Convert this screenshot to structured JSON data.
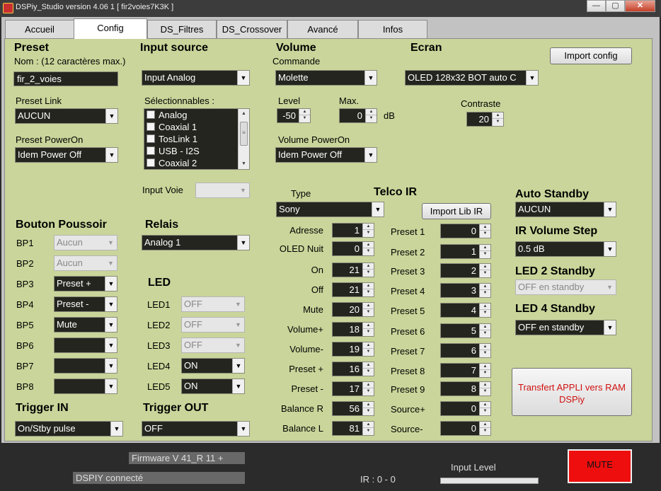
{
  "window": {
    "title": "DSPiy_Studio version 4.06 1 [ fir2voies7K3K ]",
    "min": "—",
    "max": "▢",
    "close": "✕"
  },
  "tabs": [
    "Accueil",
    "Config",
    "DS_Filtres",
    "DS_Crossover",
    "Avancé",
    "Infos"
  ],
  "preset": {
    "heading": "Preset",
    "name_hint": "Nom : (12 caractères max.)",
    "name_value": "fir_2_voies",
    "link_label": "Preset Link",
    "link_value": "AUCUN",
    "poweron_label": "Preset PowerOn",
    "poweron_value": "Idem Power Off"
  },
  "input": {
    "heading": "Input source",
    "value": "Input Analog",
    "selectable_label": "Sélectionnables :",
    "items": [
      "Analog",
      "Coaxial 1",
      "TosLink 1",
      "USB - I2S",
      "Coaxial 2"
    ],
    "voie_label": "Input Voie",
    "voie_value": ""
  },
  "volume": {
    "heading": "Volume",
    "commande_label": "Commande",
    "commande_value": "Molette",
    "level_label": "Level",
    "level_value": "-50",
    "max_label": "Max.",
    "max_value": "0",
    "unit": "dB",
    "poweron_label": "Volume PowerOn",
    "poweron_value": "Idem Power Off"
  },
  "ecran": {
    "heading": "Ecran",
    "value": "OLED 128x32 BOT auto C",
    "contraste_label": "Contraste",
    "contraste_value": "20"
  },
  "import_config": "Import config",
  "bouton": {
    "heading": "Bouton Poussoir",
    "rows": [
      {
        "label": "BP1",
        "value": "Aucun",
        "disabled": true
      },
      {
        "label": "BP2",
        "value": "Aucun",
        "disabled": true
      },
      {
        "label": "BP3",
        "value": "Preset +",
        "disabled": false
      },
      {
        "label": "BP4",
        "value": "Preset -",
        "disabled": false
      },
      {
        "label": "BP5",
        "value": "Mute",
        "disabled": false
      },
      {
        "label": "BP6",
        "value": "",
        "disabled": false
      },
      {
        "label": "BP7",
        "value": "",
        "disabled": false
      },
      {
        "label": "BP8",
        "value": "",
        "disabled": false
      }
    ]
  },
  "relais": {
    "heading": "Relais",
    "value": "Analog 1"
  },
  "led": {
    "heading": "LED",
    "rows": [
      {
        "label": "LED1",
        "value": "OFF",
        "disabled": true
      },
      {
        "label": "LED2",
        "value": "OFF",
        "disabled": true
      },
      {
        "label": "LED3",
        "value": "OFF",
        "disabled": true
      },
      {
        "label": "LED4",
        "value": "ON",
        "disabled": false
      },
      {
        "label": "LED5",
        "value": "ON",
        "disabled": false
      }
    ]
  },
  "trigger_in": {
    "heading": "Trigger IN",
    "value": "On/Stby pulse"
  },
  "trigger_out": {
    "heading": "Trigger OUT",
    "value": "OFF"
  },
  "telco": {
    "type_label": "Type",
    "heading": "Telco IR",
    "type_value": "Sony",
    "import_lib": "Import Lib IR",
    "codes": [
      {
        "label": "Adresse",
        "value": "1"
      },
      {
        "label": "OLED Nuit",
        "value": "0"
      },
      {
        "label": "On",
        "value": "21"
      },
      {
        "label": "Off",
        "value": "21"
      },
      {
        "label": "Mute",
        "value": "20"
      },
      {
        "label": "Volume+",
        "value": "18"
      },
      {
        "label": "Volume-",
        "value": "19"
      },
      {
        "label": "Preset +",
        "value": "16"
      },
      {
        "label": "Preset -",
        "value": "17"
      },
      {
        "label": "Balance R",
        "value": "56"
      },
      {
        "label": "Balance L",
        "value": "81"
      }
    ],
    "presets": [
      {
        "label": "Preset 1",
        "value": "0"
      },
      {
        "label": "Preset 2",
        "value": "1"
      },
      {
        "label": "Preset 3",
        "value": "2"
      },
      {
        "label": "Preset 4",
        "value": "3"
      },
      {
        "label": "Preset 5",
        "value": "4"
      },
      {
        "label": "Preset 6",
        "value": "5"
      },
      {
        "label": "Preset 7",
        "value": "6"
      },
      {
        "label": "Preset 8",
        "value": "7"
      },
      {
        "label": "Preset 9",
        "value": "8"
      },
      {
        "label": "Source+",
        "value": "0"
      },
      {
        "label": "Source-",
        "value": "0"
      }
    ]
  },
  "standby": {
    "auto_heading": "Auto Standby",
    "auto_value": "AUCUN",
    "irstep_heading": "IR Volume Step",
    "irstep_value": "0.5 dB",
    "led2_heading": "LED 2 Standby",
    "led2_value": "OFF en standby",
    "led4_heading": "LED 4 Standby",
    "led4_value": "OFF en standby"
  },
  "transfer": {
    "line1": "Transfert APPLI vers RAM",
    "line2": "DSPiy"
  },
  "status": {
    "firmware": "Firmware V 41_R 11 +",
    "connected": "DSPIY connecté",
    "ir": "IR : 0 - 0",
    "input_level": "Input Level",
    "mute": "MUTE"
  }
}
